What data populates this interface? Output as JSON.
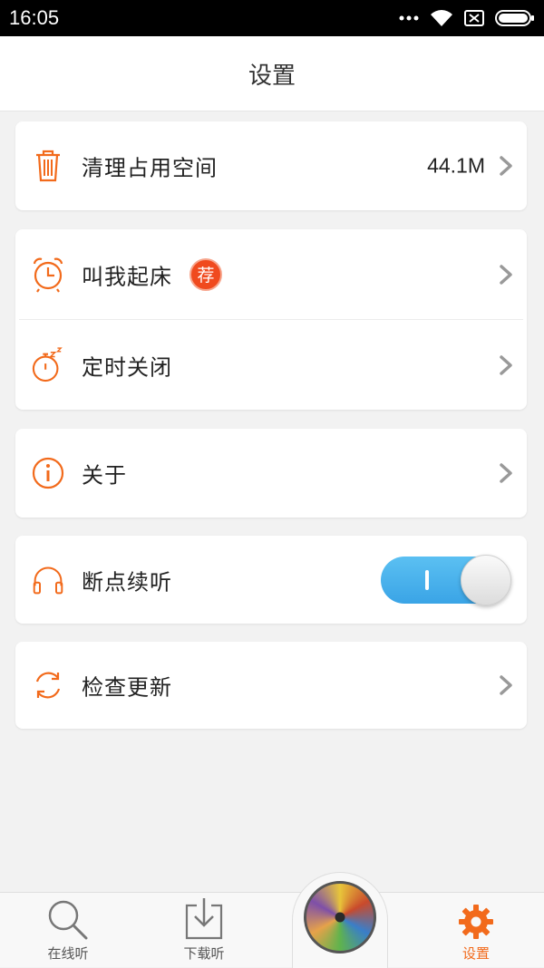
{
  "status_bar": {
    "time": "16:05",
    "icons": [
      "more-dots-icon",
      "wifi-icon",
      "sim-off-icon",
      "battery-icon"
    ]
  },
  "header": {
    "title": "设置"
  },
  "settings": {
    "clear_cache": {
      "label": "清理占用空间",
      "value": "44.1M",
      "icon": "trash-icon"
    },
    "alarm": {
      "label": "叫我起床",
      "badge": "荐",
      "icon": "alarm-clock-icon"
    },
    "sleep_timer": {
      "label": "定时关闭",
      "icon": "stopwatch-zz-icon"
    },
    "about": {
      "label": "关于",
      "icon": "info-icon"
    },
    "resume_play": {
      "label": "断点续听",
      "icon": "headphones-icon",
      "enabled": true
    },
    "check_update": {
      "label": "检查更新",
      "icon": "refresh-icon"
    }
  },
  "tab_bar": {
    "tabs": [
      {
        "label": "在线听",
        "icon": "search-icon",
        "active": false
      },
      {
        "label": "下载听",
        "icon": "download-icon",
        "active": false
      },
      {
        "label": "设置",
        "icon": "gear-icon",
        "active": true
      }
    ],
    "player_icon": "now-playing-cover"
  },
  "colors": {
    "accent": "#f26a1b",
    "toggle_on": "#3aa4e6",
    "badge": "#f04a1e",
    "background": "#f2f2f2"
  }
}
